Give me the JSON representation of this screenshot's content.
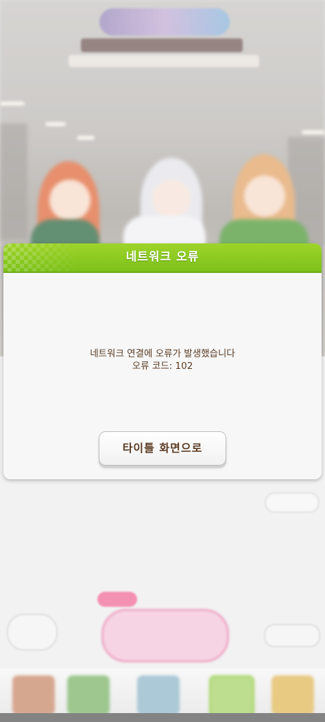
{
  "dialog": {
    "title": "네트워크 오류",
    "message_line1": "네트워크 연결에 오류가 발생했습니다",
    "message_line2": "오류 코드: 102",
    "button_label": "타이틀 화면으로"
  },
  "colors": {
    "header_green": "#8cca22",
    "text_brown": "#5b3b22",
    "race_pink": "#f06c9a"
  }
}
